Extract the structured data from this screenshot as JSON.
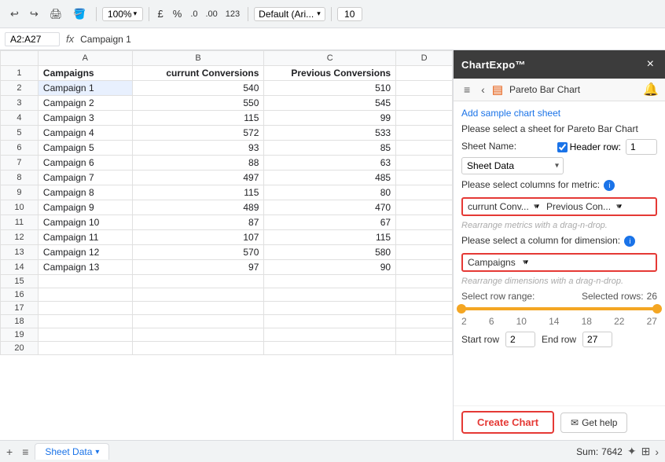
{
  "toolbar": {
    "zoom": "100%",
    "currency": "£",
    "percent": "%",
    "format1": ".0",
    "format2": ".00",
    "format3": "123",
    "font": "Default (Ari...",
    "font_size": "10",
    "undo_label": "Undo",
    "redo_label": "Redo",
    "print_label": "Print",
    "format_label": "Format"
  },
  "formula_bar": {
    "cell_ref": "A2:A27",
    "fx": "fx",
    "value": "Campaign 1"
  },
  "spreadsheet": {
    "columns": [
      "",
      "A",
      "B",
      "C",
      "D"
    ],
    "header_row": {
      "col_a": "Campaigns",
      "col_b": "currunt Conversions",
      "col_c": "Previous Conversions",
      "col_d": ""
    },
    "rows": [
      {
        "num": "1",
        "a": "Campaigns",
        "b": "currunt Conversions",
        "c": "Previous Conversions",
        "d": ""
      },
      {
        "num": "2",
        "a": "Campaign 1",
        "b": "540",
        "c": "510",
        "d": ""
      },
      {
        "num": "3",
        "a": "Campaign 2",
        "b": "550",
        "c": "545",
        "d": ""
      },
      {
        "num": "4",
        "a": "Campaign 3",
        "b": "115",
        "c": "99",
        "d": ""
      },
      {
        "num": "5",
        "a": "Campaign 4",
        "b": "572",
        "c": "533",
        "d": ""
      },
      {
        "num": "6",
        "a": "Campaign 5",
        "b": "93",
        "c": "85",
        "d": ""
      },
      {
        "num": "7",
        "a": "Campaign 6",
        "b": "88",
        "c": "63",
        "d": ""
      },
      {
        "num": "8",
        "a": "Campaign 7",
        "b": "497",
        "c": "485",
        "d": ""
      },
      {
        "num": "9",
        "a": "Campaign 8",
        "b": "115",
        "c": "80",
        "d": ""
      },
      {
        "num": "10",
        "a": "Campaign 9",
        "b": "489",
        "c": "470",
        "d": ""
      },
      {
        "num": "11",
        "a": "Campaign 10",
        "b": "87",
        "c": "67",
        "d": ""
      },
      {
        "num": "12",
        "a": "Campaign 11",
        "b": "107",
        "c": "115",
        "d": ""
      },
      {
        "num": "13",
        "a": "Campaign 12",
        "b": "570",
        "c": "580",
        "d": ""
      },
      {
        "num": "14",
        "a": "Campaign 13",
        "b": "97",
        "c": "90",
        "d": ""
      },
      {
        "num": "15",
        "a": "",
        "b": "",
        "c": "",
        "d": ""
      },
      {
        "num": "16",
        "a": "",
        "b": "",
        "c": "",
        "d": ""
      },
      {
        "num": "17",
        "a": "",
        "b": "",
        "c": "",
        "d": ""
      },
      {
        "num": "18",
        "a": "",
        "b": "",
        "c": "",
        "d": ""
      },
      {
        "num": "19",
        "a": "",
        "b": "",
        "c": "",
        "d": ""
      },
      {
        "num": "20",
        "a": "",
        "b": "",
        "c": "",
        "d": ""
      }
    ]
  },
  "sheet_tabs": {
    "add_label": "+",
    "menu_label": "≡",
    "tab_name": "Sheet Data",
    "tab_dropdown": "▾"
  },
  "status_bar": {
    "sum_label": "Sum:",
    "sum_value": "7642",
    "explore_icon": "✦",
    "sheets_icon": "⊞"
  },
  "panel": {
    "title": "ChartExpo™",
    "close_label": "×",
    "toolbar": {
      "menu_icon": "≡",
      "back_icon": "‹",
      "chart_icon": "▤",
      "chart_title": "Pareto Bar Chart",
      "notification_icon": "🔔"
    },
    "add_sample_link": "Add sample chart sheet",
    "description": "Please select a sheet for Pareto Bar Chart",
    "sheet_name_label": "Sheet Name:",
    "header_row_label": "Header row:",
    "sheet_options": [
      "Sheet Data"
    ],
    "sheet_selected": "Sheet Data",
    "header_row_value": "1",
    "metric_label": "Please select columns for metric:",
    "metric_options_1": [
      "currunt Conv..."
    ],
    "metric_selected_1": "currunt Conv...",
    "metric_options_2": [
      "Previous Con..."
    ],
    "metric_selected_2": "Previous Con...",
    "rearrange_metric_hint": "Rearrange metrics with a drag-n-drop.",
    "dimension_label": "Please select a column for dimension:",
    "dimension_options": [
      "Campaigns"
    ],
    "dimension_selected": "Campaigns",
    "rearrange_dimension_hint": "Rearrange dimensions with a drag-n-drop.",
    "row_range_label": "Select row range:",
    "selected_rows_label": "Selected rows:",
    "selected_rows_value": "26",
    "slider_ticks": [
      "2",
      "6",
      "10",
      "14",
      "18",
      "22",
      "27"
    ],
    "start_row_label": "Start row",
    "start_row_value": "2",
    "end_row_label": "End row",
    "end_row_value": "27",
    "create_chart_label": "Create Chart",
    "get_help_label": "Get help",
    "mail_icon": "✉"
  }
}
